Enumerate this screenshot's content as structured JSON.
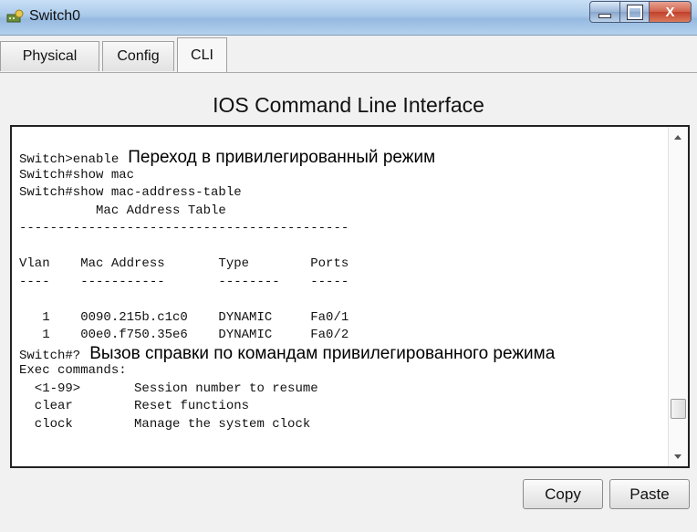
{
  "window": {
    "title": "Switch0",
    "icon": "switch-app-icon",
    "controls": {
      "minimize": "minimize-icon",
      "maximize": "maximize-icon",
      "close": "X"
    }
  },
  "tabs": [
    {
      "label": "Physical",
      "active": false
    },
    {
      "label": "Config",
      "active": false
    },
    {
      "label": "CLI",
      "active": true
    }
  ],
  "heading": "IOS Command Line Interface",
  "terminal": {
    "lines": [
      {
        "code": "Switch>enable",
        "note": "Переход в привилегированный режим"
      },
      {
        "code": "Switch#show mac",
        "note": ""
      },
      {
        "code": "Switch#show mac-address-table",
        "note": ""
      },
      {
        "code": "          Mac Address Table",
        "note": ""
      },
      {
        "code": "-------------------------------------------",
        "note": ""
      },
      {
        "code": "",
        "note": ""
      },
      {
        "code": "Vlan    Mac Address       Type        Ports",
        "note": ""
      },
      {
        "code": "----    -----------       --------    -----",
        "note": ""
      },
      {
        "code": "",
        "note": ""
      },
      {
        "code": "   1    0090.215b.c1c0    DYNAMIC     Fa0/1",
        "note": ""
      },
      {
        "code": "   1    00e0.f750.35e6    DYNAMIC     Fa0/2",
        "note": ""
      },
      {
        "code": "Switch#?",
        "note": "Вызов справки по командам привилегированного режима"
      },
      {
        "code": "Exec commands:",
        "note": ""
      },
      {
        "code": "  <1-99>       Session number to resume",
        "note": ""
      },
      {
        "code": "  clear        Reset functions",
        "note": ""
      },
      {
        "code": "  clock        Manage the system clock",
        "note": ""
      }
    ]
  },
  "buttons": {
    "copy": "Copy",
    "paste": "Paste"
  },
  "colors": {
    "titlebar": "#a9c9ea",
    "close_button": "#c1402a",
    "terminal_bg": "#ffffff"
  }
}
